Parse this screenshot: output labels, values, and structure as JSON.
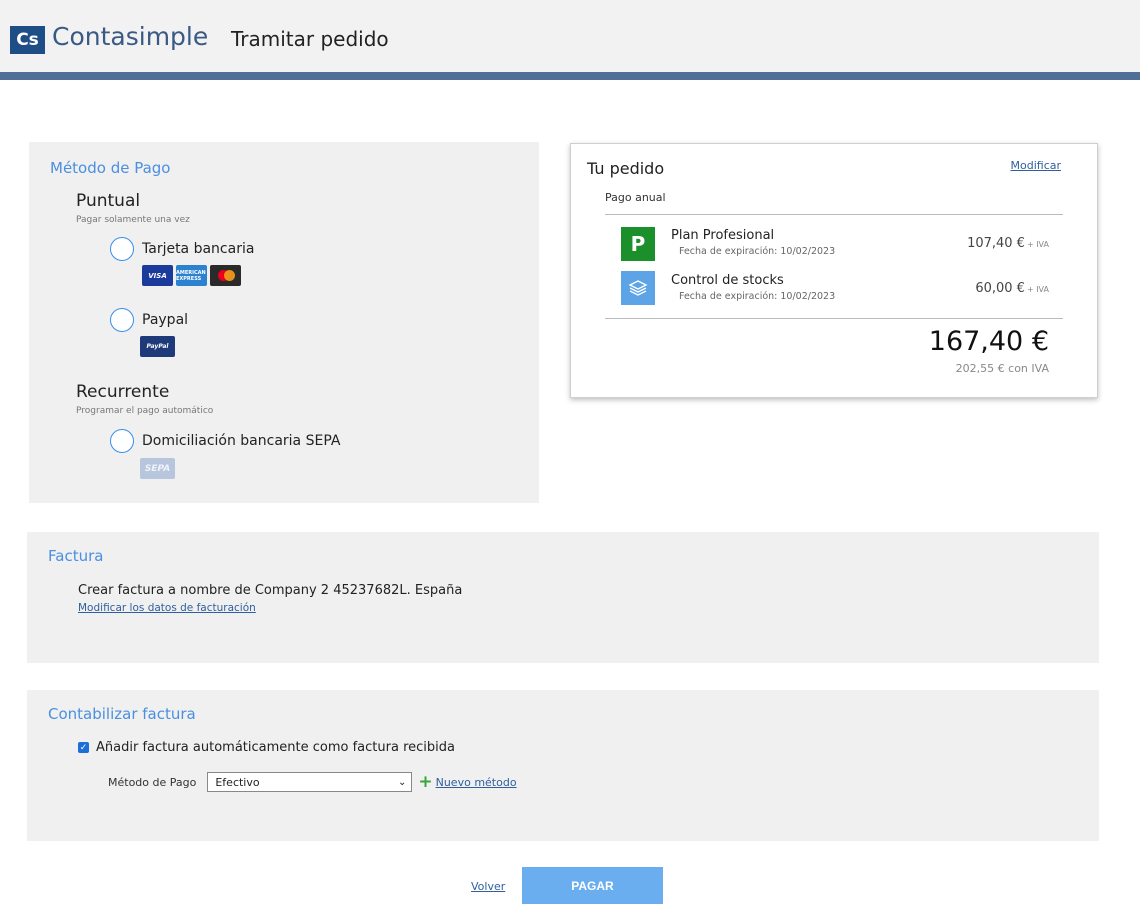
{
  "header": {
    "logo_badge": "Cs",
    "logo_text": "Contasimple",
    "page_title": "Tramitar pedido",
    "stripe_color": "#4f6f96"
  },
  "payment": {
    "title": "Método de Pago",
    "puntual": {
      "title": "Puntual",
      "subtitle": "Pagar solamente una vez",
      "options": [
        {
          "label": "Tarjeta bancaria",
          "logos": [
            "VISA",
            "AMERICAN EXPRESS",
            "mastercard"
          ]
        },
        {
          "label": "Paypal",
          "logos": [
            "PayPal"
          ]
        }
      ]
    },
    "recurrente": {
      "title": "Recurrente",
      "subtitle": "Programar el pago automático",
      "options": [
        {
          "label": "Domiciliación bancaria SEPA",
          "logos": [
            "SEPA"
          ]
        }
      ]
    }
  },
  "order": {
    "title": "Tu pedido",
    "modify_label": "Modificar",
    "subtitle": "Pago anual",
    "items": [
      {
        "icon": "plan-profesional-icon",
        "icon_text": "P",
        "name": "Plan Profesional",
        "date": "Fecha de expiración: 10/02/2023",
        "price": "107,40 €",
        "price_suffix": "+ IVA"
      },
      {
        "icon": "stock-layers-icon",
        "name": "Control de stocks",
        "date": "Fecha de expiración: 10/02/2023",
        "price": "60,00 €",
        "price_suffix": "+ IVA"
      }
    ],
    "total": "167,40 €",
    "total_with_iva": "202,55 € con IVA"
  },
  "invoice": {
    "title": "Factura",
    "text": "Crear factura a nombre de Company 2 45237682L. España",
    "modify_link": "Modificar los datos de facturación"
  },
  "accounting": {
    "title": "Contabilizar factura",
    "checkbox_label": "Añadir factura automáticamente como factura recibida",
    "checkbox_checked": true,
    "method_label": "Método de Pago",
    "method_value": "Efectivo",
    "new_method_label": "Nuevo método"
  },
  "actions": {
    "back_label": "Volver",
    "pay_label": "PAGAR",
    "pay_color": "#6aaef0"
  }
}
